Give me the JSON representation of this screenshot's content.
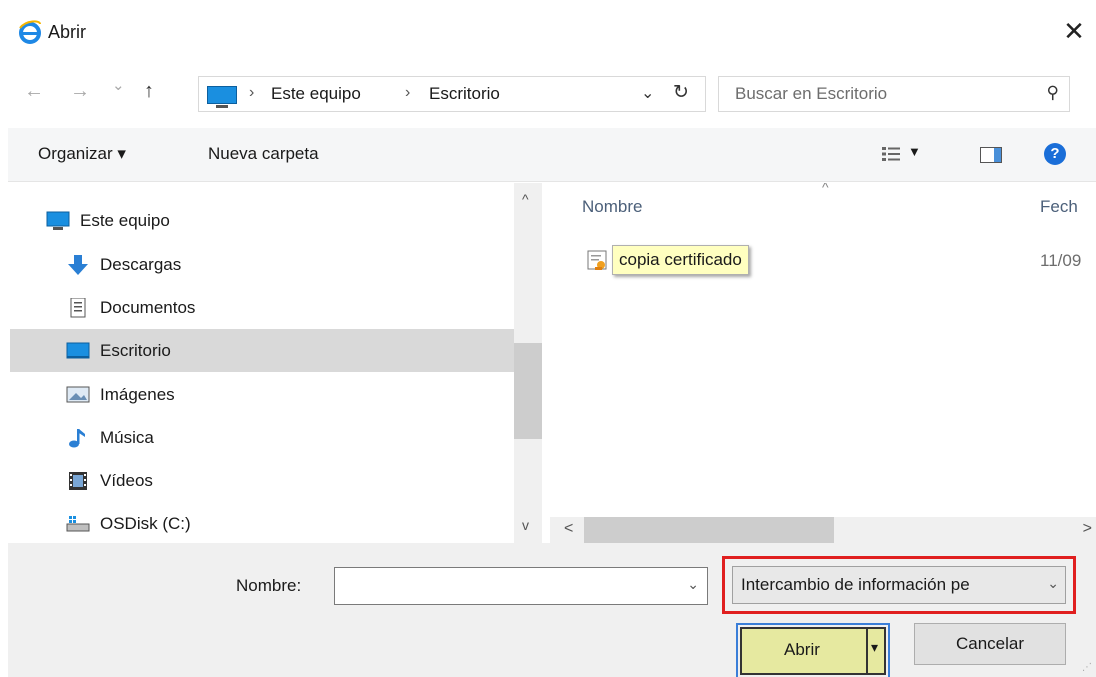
{
  "window": {
    "title": "Abrir",
    "close_glyph": "✕"
  },
  "nav": {
    "back_glyph": "←",
    "forward_glyph": "→",
    "recent_glyph": "⌄",
    "up_glyph": "↑",
    "breadcrumb": [
      "Este equipo",
      "Escritorio"
    ],
    "crumb_separator": "›",
    "dropdown_glyph": "⌄",
    "refresh_glyph": "↻",
    "search_placeholder": "Buscar en Escritorio",
    "search_glyph": "⚲"
  },
  "toolbar": {
    "organize_label": "Organizar ▾",
    "new_folder_label": "Nueva carpeta",
    "view_dd": "▼",
    "help": "?"
  },
  "tree": {
    "items": [
      {
        "label": "Este equipo",
        "icon": "computer-icon"
      },
      {
        "label": "Descargas",
        "icon": "downloads-icon"
      },
      {
        "label": "Documentos",
        "icon": "documents-icon"
      },
      {
        "label": "Escritorio",
        "icon": "desktop-icon",
        "selected": true
      },
      {
        "label": "Imágenes",
        "icon": "pictures-icon"
      },
      {
        "label": "Música",
        "icon": "music-icon"
      },
      {
        "label": "Vídeos",
        "icon": "videos-icon"
      },
      {
        "label": "OSDisk (C:)",
        "icon": "drive-icon"
      }
    ],
    "scroll_up": "^",
    "scroll_down": "v"
  },
  "files": {
    "columns": [
      "Nombre",
      "Fech"
    ],
    "sort_glyph": "^",
    "rows": [
      {
        "name": "copia certificado",
        "date": "11/09"
      }
    ],
    "scroll_left": "<",
    "scroll_right": ">"
  },
  "bottom": {
    "filename_label": "Nombre:",
    "filename_value": "",
    "filename_dd": "⌄",
    "file_type_value": "Intercambio de información pe",
    "file_type_dd": "⌄",
    "open_label": "Abrir",
    "open_dd": "▾",
    "cancel_label": "Cancelar"
  },
  "colors": {
    "highlight_border": "#e01f1f",
    "open_button_bg": "#e6e9a0",
    "tooltip_bg": "#ffffc0"
  }
}
